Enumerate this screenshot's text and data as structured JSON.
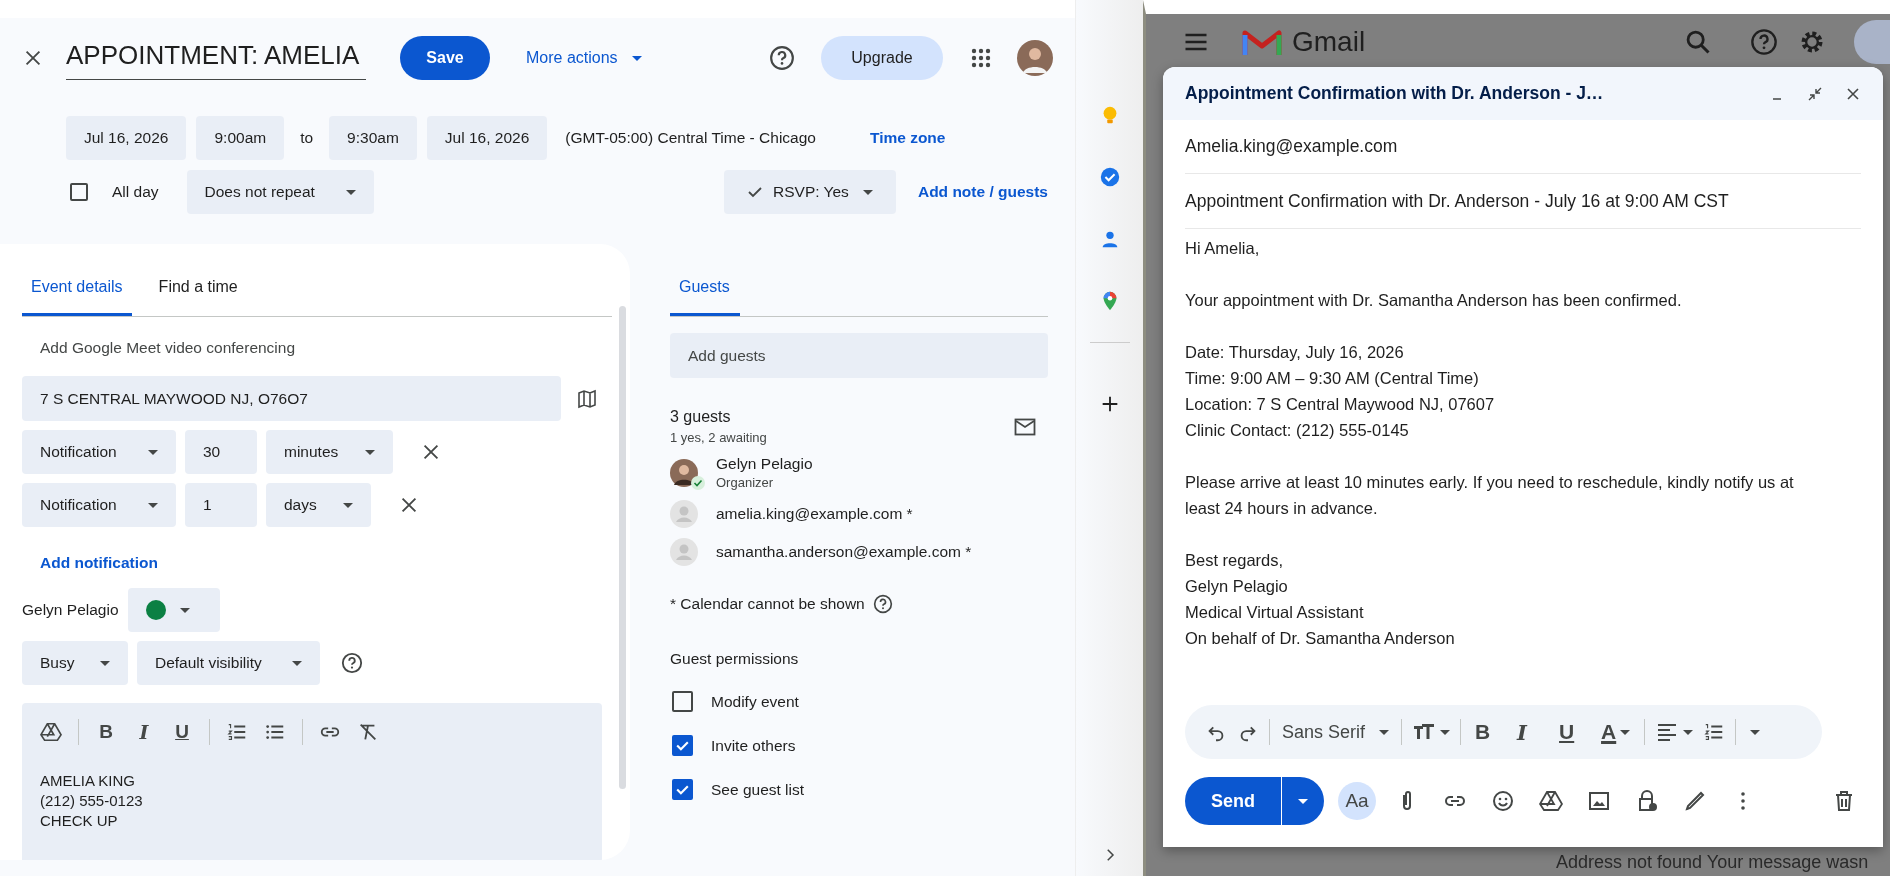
{
  "calendar": {
    "title": "APPOINTMENT: AMELIA",
    "save": "Save",
    "more_actions": "More actions",
    "upgrade": "Upgrade",
    "start_date": "Jul 16, 2026",
    "start_time": "9:00am",
    "to": "to",
    "end_time": "9:30am",
    "end_date": "Jul 16, 2026",
    "timezone": "(GMT-05:00) Central Time - Chicago",
    "timezone_link": "Time zone",
    "all_day": {
      "label": "All day",
      "checked": false
    },
    "repeat": "Does not repeat",
    "rsvp": "RSVP: Yes",
    "add_note": "Add note / guests",
    "tabs": [
      {
        "label": "Event details",
        "selected": true
      },
      {
        "label": "Find a time",
        "selected": false
      }
    ],
    "meet": "Add Google Meet video conferencing",
    "location": "7 S CENTRAL MAYWOOD NJ, O76O7",
    "notifications": [
      {
        "type": "Notification",
        "amount": "30",
        "unit": "minutes"
      },
      {
        "type": "Notification",
        "amount": "1",
        "unit": "days"
      }
    ],
    "add_notification": "Add notification",
    "calendar_owner": {
      "name": "Gelyn Pelagio",
      "color": "#0b8043"
    },
    "availability": "Busy",
    "visibility": "Default visibility",
    "format_buttons": [
      "B",
      "I",
      "U"
    ],
    "description": [
      "AMELIA KING",
      "(212) 555-0123",
      "CHECK UP"
    ],
    "guests_tab": {
      "label": "Guests",
      "selected": true
    },
    "add_guests": {
      "placeholder": "Add guests"
    },
    "guest_count": "3 guests",
    "guest_summary": "1 yes, 2 awaiting",
    "guests": [
      {
        "name": "Gelyn Pelagio",
        "role": "Organizer",
        "kind": "photo",
        "responded": true
      },
      {
        "name": "amelia.king@example.com *",
        "kind": "generic",
        "responded": false
      },
      {
        "name": "samantha.anderson@example.com *",
        "kind": "generic",
        "responded": false
      }
    ],
    "footnote": "* Calendar cannot be shown",
    "permissions_title": "Guest permissions",
    "permissions": [
      {
        "label": "Modify event",
        "checked": false
      },
      {
        "label": "Invite others",
        "checked": true
      },
      {
        "label": "See guest list",
        "checked": true
      }
    ]
  },
  "gmail": {
    "brand": "Gmail",
    "background_text": "Address not found  Your message wasn",
    "compose": {
      "title": "Appointment Confirmation with Dr. Anderson - J…",
      "to": "Amelia.king@example.com",
      "subject": "Appointment Confirmation with Dr. Anderson - July 16 at 9:00 AM CST",
      "body": [
        [
          "Hi Amelia,"
        ],
        [
          "Your appointment with Dr. Samantha Anderson has been confirmed."
        ],
        [
          "Date: Thursday, July 16, 2026",
          "Time: 9:00 AM – 9:30 AM (Central Time)",
          "Location: 7 S Central Maywood NJ, 07607",
          "Clinic Contact:  (212) 555-0145"
        ],
        [
          "Please arrive at least 10 minutes early. If you need to reschedule, kindly notify us at least 24 hours in advance."
        ],
        [
          "Best regards,",
          "Gelyn Pelagio",
          "Medical Virtual Assistant",
          "On behalf of Dr. Samantha Anderson"
        ]
      ],
      "font": "Sans Serif",
      "format_buttons": [
        "B",
        "I",
        "U",
        "A"
      ],
      "send": "Send",
      "formatting": "Aa"
    }
  }
}
